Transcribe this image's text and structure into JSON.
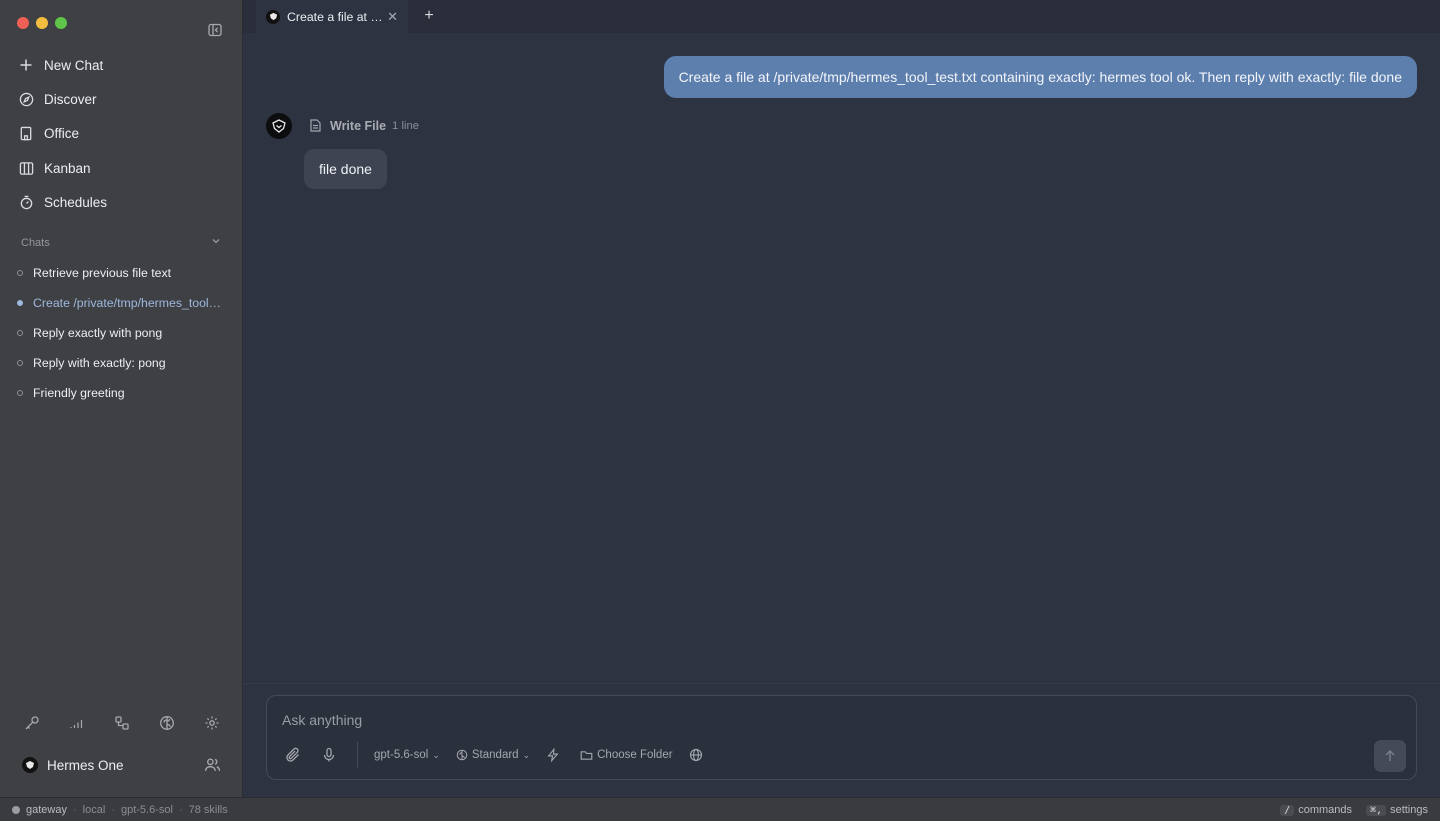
{
  "window": {
    "traffic_lights": [
      "close",
      "minimize",
      "zoom"
    ],
    "colors": {
      "close": "#ee5f56",
      "minimize": "#f3bd3f",
      "zoom": "#5fc44a"
    }
  },
  "sidebar": {
    "nav": [
      {
        "icon": "plus-icon",
        "label": "New Chat"
      },
      {
        "icon": "compass-icon",
        "label": "Discover"
      },
      {
        "icon": "building-icon",
        "label": "Office"
      },
      {
        "icon": "kanban-icon",
        "label": "Kanban"
      },
      {
        "icon": "timer-icon",
        "label": "Schedules"
      }
    ],
    "chats_header": "Chats",
    "chats": [
      {
        "title": "Retrieve previous file text",
        "active": false
      },
      {
        "title": "Create /private/tmp/hermes_tool…",
        "active": true
      },
      {
        "title": "Reply exactly with pong",
        "active": false
      },
      {
        "title": "Reply with exactly: pong",
        "active": false
      },
      {
        "title": "Friendly greeting",
        "active": false
      }
    ],
    "bottom_icons": [
      "key-icon",
      "signal-icon",
      "nodes-icon",
      "brain-icon",
      "gear-icon"
    ],
    "profile_name": "Hermes One"
  },
  "tabs": [
    {
      "title": "Create a file at …",
      "active": true
    }
  ],
  "conversation": {
    "user_message": "Create a file at /private/tmp/hermes_tool_test.txt containing exactly: hermes tool ok. Then reply with exactly: file done",
    "tool_call": {
      "name": "Write File",
      "meta": "1 line"
    },
    "assistant_message": "file done"
  },
  "composer": {
    "placeholder": "Ask anything",
    "model": "gpt-5.6-sol",
    "mode": "Standard",
    "folder_label": "Choose Folder"
  },
  "statusbar": {
    "gateway": "gateway",
    "location": "local",
    "model": "gpt-5.6-sol",
    "skills": "78 skills",
    "commands_key": "/",
    "commands_label": "commands",
    "settings_key": "⌘,",
    "settings_label": "settings"
  },
  "accent_color": "#5d7fae"
}
